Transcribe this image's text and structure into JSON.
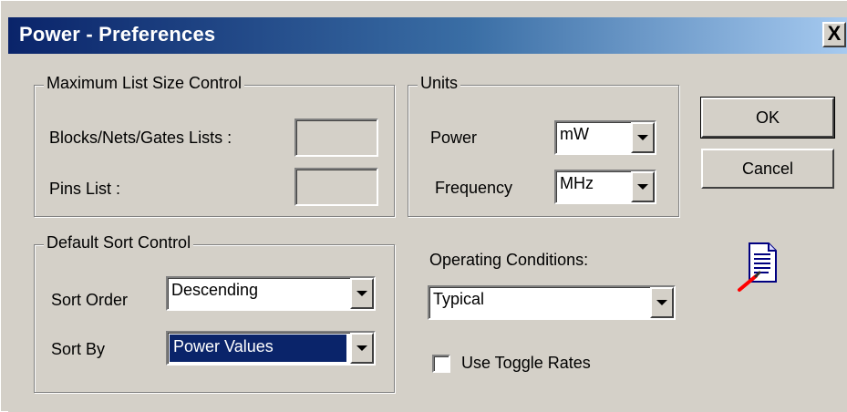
{
  "window": {
    "title": "Power - Preferences",
    "close_label": "X"
  },
  "max_list_size": {
    "title": "Maximum List Size Control",
    "blocks_label": "Blocks/Nets/Gates Lists :",
    "blocks_value": "",
    "pins_label": "Pins List :",
    "pins_value": ""
  },
  "units": {
    "title": "Units",
    "power_label": "Power",
    "power_value": "mW",
    "frequency_label": "Frequency",
    "frequency_value": "MHz"
  },
  "buttons": {
    "ok": "OK",
    "cancel": "Cancel"
  },
  "sort_control": {
    "title": "Default Sort Control",
    "order_label": "Sort Order",
    "order_value": "Descending",
    "by_label": "Sort By",
    "by_value": "Power Values"
  },
  "operating": {
    "label": "Operating Conditions:",
    "value": "Typical"
  },
  "toggle": {
    "label": "Use Toggle Rates",
    "checked": false
  },
  "icons": {
    "notes": "notepad-pencil-icon",
    "dropdown": "dropdown-arrow-icon"
  },
  "colors": {
    "title_start": "#0a246a",
    "title_end": "#a6caf0",
    "face": "#d4d0c8",
    "selection": "#0a246a"
  }
}
